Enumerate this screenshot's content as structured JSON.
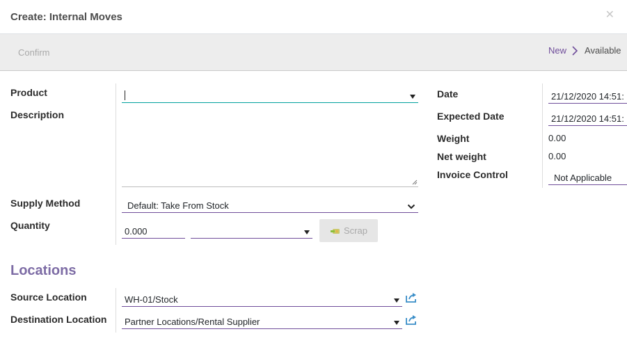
{
  "dialog": {
    "title": "Create: Internal Moves"
  },
  "toolbar": {
    "confirm_label": "Confirm",
    "status": {
      "current": "New",
      "next": "Available"
    }
  },
  "form": {
    "product": {
      "label": "Product",
      "value": ""
    },
    "description": {
      "label": "Description",
      "value": ""
    },
    "supply_method": {
      "label": "Supply Method",
      "value": "Default: Take From Stock"
    },
    "quantity": {
      "label": "Quantity",
      "value": "0.000",
      "uom": ""
    },
    "scrap_label": "Scrap",
    "date": {
      "label": "Date",
      "value": "21/12/2020 14:51:"
    },
    "expected_date": {
      "label": "Expected Date",
      "value": "21/12/2020 14:51:"
    },
    "weight": {
      "label": "Weight",
      "value": "0.00"
    },
    "net_weight": {
      "label": "Net weight",
      "value": "0.00"
    },
    "invoice_control": {
      "label": "Invoice Control",
      "value": "Not Applicable"
    }
  },
  "locations": {
    "title": "Locations",
    "source": {
      "label": "Source Location",
      "value": "WH-01/Stock"
    },
    "destination": {
      "label": "Destination Location",
      "value": "Partner Locations/Rental Supplier"
    }
  },
  "colors": {
    "accent": "#6f4d9a",
    "focus": "#00a09d",
    "section": "#7d6ca5",
    "link_icon": "#3a8ec8"
  },
  "icons": [
    "close-icon",
    "chevron-right-icon",
    "caret-down-icon",
    "chevron-down-icon",
    "scrap-icon",
    "external-link-icon",
    "resize-grip-icon"
  ]
}
